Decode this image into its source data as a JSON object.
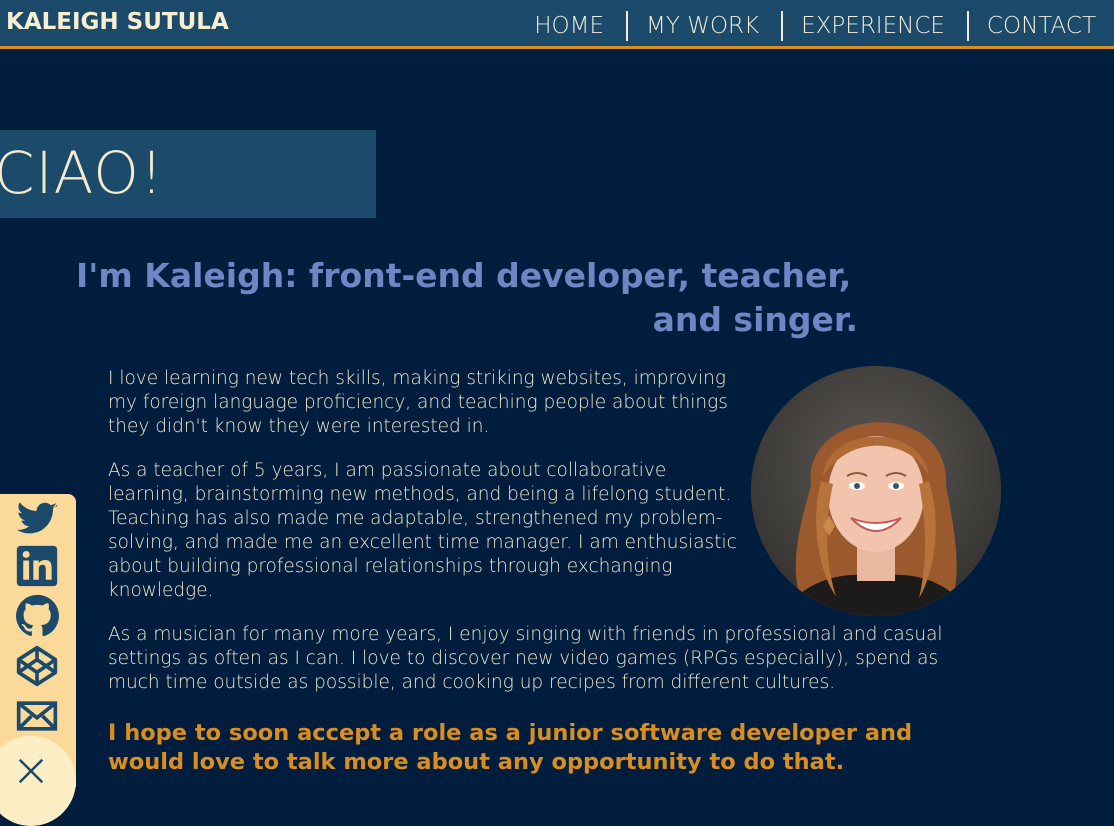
{
  "header": {
    "brand": "KALEIGH SUTULA",
    "nav": [
      "HOME",
      "MY WORK",
      "EXPERIENCE",
      "CONTACT"
    ]
  },
  "hero": {
    "greeting": "CIAO!",
    "headline_line1": "I'm Kaleigh: front-end developer, teacher,",
    "headline_line2": "and singer."
  },
  "about": {
    "paragraph1": "I love learning new tech skills, making striking websites, improving my foreign language proficiency, and teaching people about things they didn't know they were interested in.",
    "paragraph2": "As a teacher of 5 years, I am passionate about collaborative learning, brainstorming new methods, and being a lifelong student. Teaching has also made me adaptable, strengthened my problem-solving, and made me an excellent time manager. I am enthusiastic about building professional relationships through exchanging knowledge.",
    "paragraph3": "As a musician for many more years, I enjoy singing with friends in professional and casual settings as often as I can. I love to discover new video games (RPGs especially), spend as much time outside as possible, and cooking up recipes from different cultures.",
    "closing": "I hope to soon accept a role as a junior software developer and would love to talk more about any opportunity to do that."
  },
  "social": {
    "icons": [
      "twitter-icon",
      "linkedin-icon",
      "github-icon",
      "codepen-icon",
      "email-icon",
      "close-icon"
    ]
  },
  "colors": {
    "background": "#001d3d",
    "header": "#1c4a6b",
    "accent": "#d98e1e",
    "headline": "#6e86c4",
    "text": "#efe7cb",
    "social_bg": "#fbd998"
  }
}
